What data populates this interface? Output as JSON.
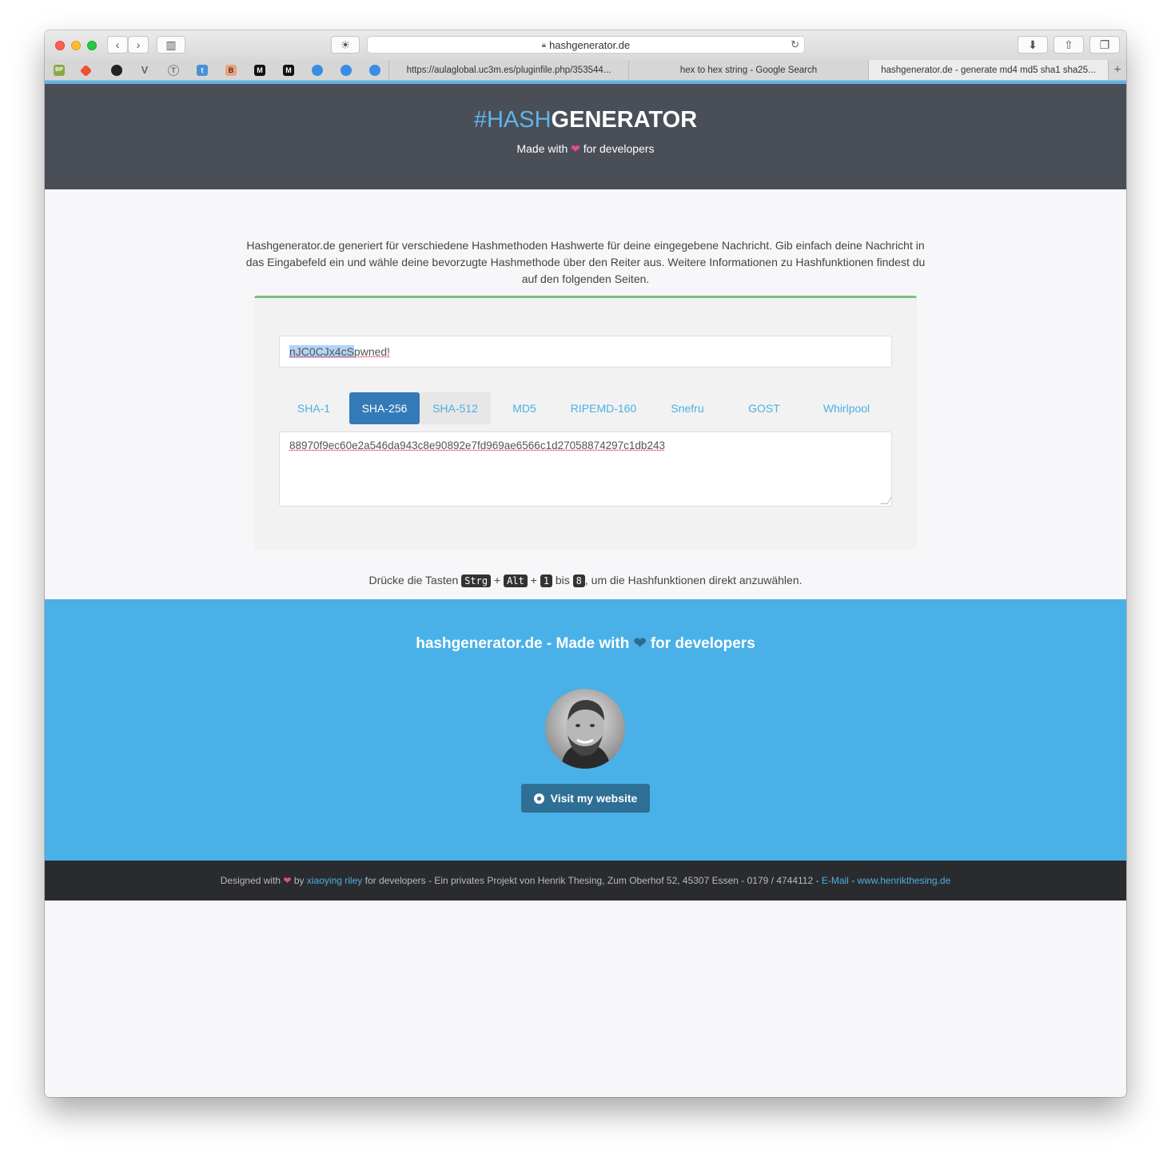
{
  "browser": {
    "url": "hashgenerator.de",
    "tabs": [
      {
        "label": "https://aulaglobal.uc3m.es/pluginfile.php/353544..."
      },
      {
        "label": "hex to hex string - Google Search"
      },
      {
        "label": "hashgenerator.de - generate md4 md5 sha1 sha25..."
      }
    ],
    "bookmarks": [
      "BP",
      "T",
      "B",
      "M",
      "M"
    ]
  },
  "header": {
    "logo_hash": "#HASH",
    "logo_generator": "GENERATOR",
    "tagline_pre": "Made with",
    "tagline_post": "for developers"
  },
  "intro": "Hashgenerator.de generiert für verschiedene Hashmethoden Hashwerte für deine eingegebene Nachricht. Gib einfach deine Nachricht in das Eingabefeld ein und wähle deine bevorzugte Hashmethode über den Reiter aus. Weitere Informationen zu Hashfunktionen findest du auf den folgenden Seiten.",
  "input": {
    "selected": "nJC0CJx4cS",
    "rest": "pwned!"
  },
  "hash_tabs": [
    "SHA-1",
    "SHA-256",
    "SHA-512",
    "MD5",
    "RIPEMD-160",
    "Snefru",
    "GOST",
    "Whirlpool"
  ],
  "active_tab": "SHA-256",
  "output": "88970f9ec60e2a546da943c8e90892e7fd969ae6566c1d27058874297c1db243",
  "hint": {
    "pre": "Drücke die Tasten",
    "key1": "Strg",
    "plus": "+",
    "key2": "Alt",
    "key3": "1",
    "bis": "bis",
    "key4": "8",
    "post": ", um die Hashfunktionen direkt anzuwählen."
  },
  "promo": {
    "title_pre": "hashgenerator.de - Made with",
    "title_post": "for developers",
    "button": "Visit my website"
  },
  "footer": {
    "pre": "Designed with",
    "by": "by",
    "author_link": "xiaoying riley",
    "mid": "for developers - Ein privates Projekt von Henrik Thesing, Zum Oberhof 52, 45307 Essen - 0179 / 4744112 -",
    "email_link": "E-Mail",
    "dash": "-",
    "site_link": "www.henrikthesing.de"
  },
  "colors": {
    "header_bg": "#4a4e57",
    "accent_blue": "#4ab0e8",
    "active_tab": "#337ab7",
    "heart": "#e84a93",
    "panel_border": "#79c17e"
  }
}
